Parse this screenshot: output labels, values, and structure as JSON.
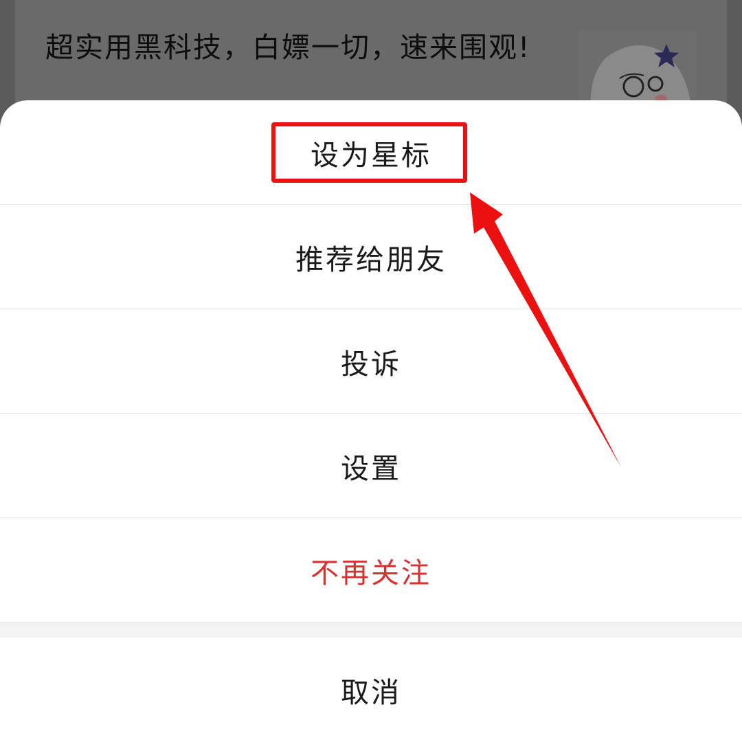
{
  "background_article": {
    "title": "超实用黑科技，白嫖一切，速来围观!",
    "thumbnail_icon": "comic-face-thumbnail"
  },
  "action_sheet": {
    "items": [
      {
        "label": "设为星标"
      },
      {
        "label": "推荐给朋友"
      },
      {
        "label": "投诉"
      },
      {
        "label": "设置"
      },
      {
        "label": "不再关注"
      }
    ],
    "cancel_label": "取消"
  },
  "annotation": {
    "highlight_color": "#ec1111",
    "arrow_color": "#ec1111",
    "highlight_target": "设为星标"
  },
  "colors": {
    "danger": "#d73131",
    "overlay": "#5b5b5b",
    "sheet_background": "#ffffff"
  }
}
